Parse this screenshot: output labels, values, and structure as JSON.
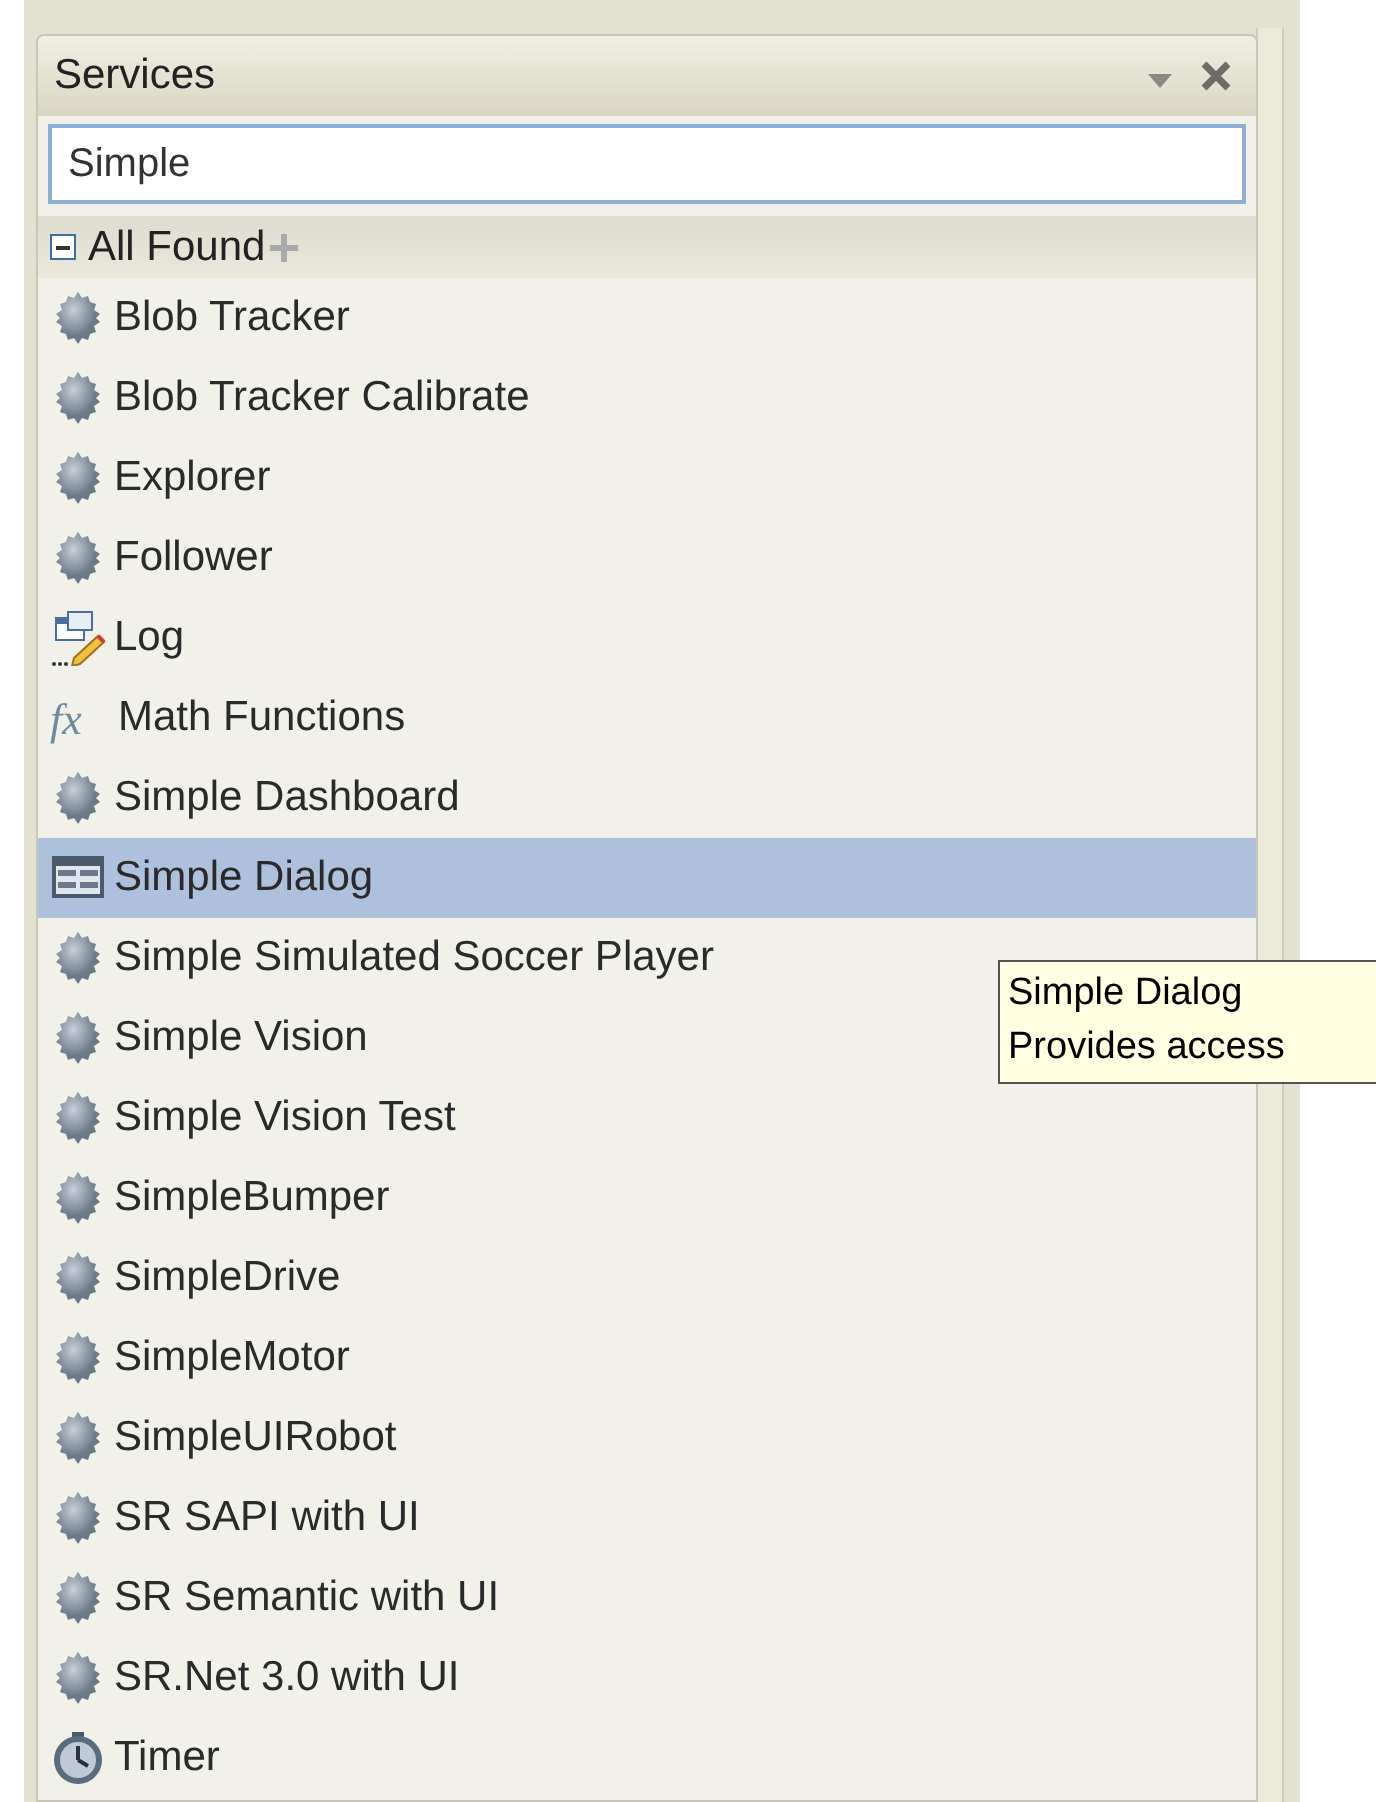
{
  "panel": {
    "title": "Services"
  },
  "search": {
    "value": "Simple"
  },
  "group": {
    "label": "All Found",
    "expanded": true
  },
  "items": [
    {
      "label": "Blob Tracker",
      "kind": "service",
      "selected": false
    },
    {
      "label": "Blob Tracker Calibrate",
      "kind": "service",
      "selected": false
    },
    {
      "label": "Explorer",
      "kind": "service",
      "selected": false
    },
    {
      "label": "Follower",
      "kind": "service",
      "selected": false
    },
    {
      "label": "Log",
      "kind": "log",
      "selected": false
    },
    {
      "label": "Math Functions",
      "kind": "function",
      "icon_text": "fx",
      "selected": false
    },
    {
      "label": "Simple Dashboard",
      "kind": "service",
      "selected": false
    },
    {
      "label": "Simple Dialog",
      "kind": "dialog",
      "selected": true
    },
    {
      "label": "Simple Simulated Soccer Player",
      "kind": "service",
      "selected": false
    },
    {
      "label": "Simple Vision",
      "kind": "service",
      "selected": false
    },
    {
      "label": "Simple Vision Test",
      "kind": "service",
      "selected": false
    },
    {
      "label": "SimpleBumper",
      "kind": "service",
      "selected": false
    },
    {
      "label": "SimpleDrive",
      "kind": "service",
      "selected": false
    },
    {
      "label": "SimpleMotor",
      "kind": "service",
      "selected": false
    },
    {
      "label": "SimpleUIRobot",
      "kind": "service",
      "selected": false
    },
    {
      "label": "SR SAPI with UI",
      "kind": "service",
      "selected": false
    },
    {
      "label": "SR Semantic with UI",
      "kind": "service",
      "selected": false
    },
    {
      "label": "SR.Net 3.0 with UI",
      "kind": "service",
      "selected": false
    },
    {
      "label": "Timer",
      "kind": "timer",
      "selected": false
    }
  ],
  "tooltip": {
    "title": "Simple Dialog",
    "text": "Provides access"
  }
}
